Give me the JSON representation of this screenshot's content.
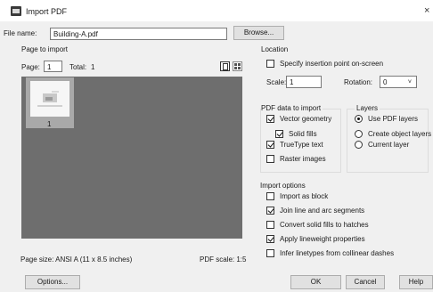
{
  "window": {
    "title": "Import PDF",
    "close_glyph": "×"
  },
  "file": {
    "label": "File name:",
    "value": "Building-A.pdf",
    "browse_label": "Browse..."
  },
  "page_to_import": {
    "group_title": "Page to import",
    "page_label": "Page:",
    "page_value": "1",
    "total_label": "Total:",
    "total_value": "1",
    "thumbnail_caption": "1",
    "page_size": "Page size: ANSI A (11 x 8.5 inches)",
    "pdf_scale": "PDF scale: 1:5"
  },
  "location": {
    "group_title": "Location",
    "specify_label": "Specify insertion point on-screen",
    "specify_checked": false,
    "scale_label": "Scale:",
    "scale_value": "1",
    "rotation_label": "Rotation:",
    "rotation_value": "0"
  },
  "pdf_data": {
    "group_title": "PDF data to import",
    "items": [
      {
        "label": "Vector geometry",
        "checked": true
      },
      {
        "label": "Solid fills",
        "checked": true
      },
      {
        "label": "TrueType text",
        "checked": true
      },
      {
        "label": "Raster images",
        "checked": false
      }
    ]
  },
  "layers": {
    "group_title": "Layers",
    "items": [
      {
        "label": "Use PDF layers",
        "selected": true
      },
      {
        "label": "Create object layers",
        "selected": false
      },
      {
        "label": "Current layer",
        "selected": false
      }
    ]
  },
  "import_options": {
    "group_title": "Import options",
    "items": [
      {
        "label": "Import as block",
        "checked": false
      },
      {
        "label": "Join line and arc segments",
        "checked": true
      },
      {
        "label": "Convert solid fills to hatches",
        "checked": false
      },
      {
        "label": "Apply lineweight properties",
        "checked": true
      },
      {
        "label": "Infer linetypes from collinear dashes",
        "checked": false
      }
    ]
  },
  "buttons": {
    "options": "Options...",
    "ok": "OK",
    "cancel": "Cancel",
    "help": "Help"
  }
}
